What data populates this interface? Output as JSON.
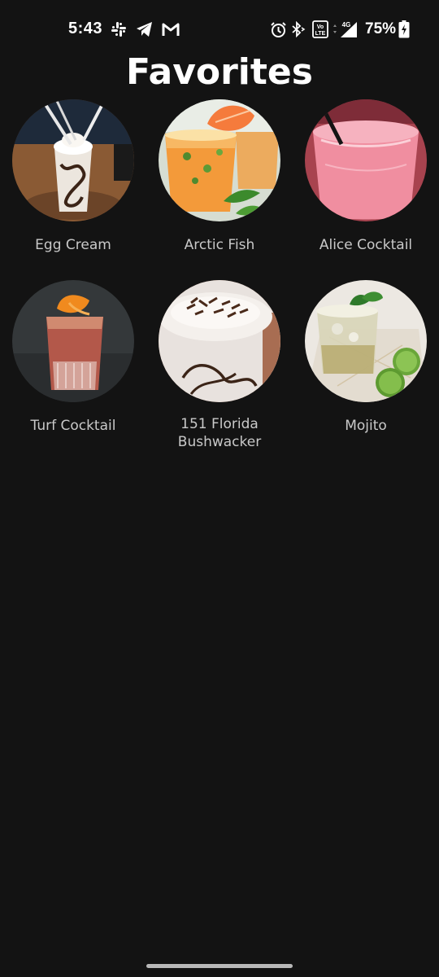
{
  "status_bar": {
    "time": "5:43",
    "battery_percent": "75%",
    "network": "4G",
    "left_icons": [
      "slack-icon",
      "telegram-icon",
      "gmail-icon"
    ],
    "right_icons": [
      "alarm-icon",
      "bluetooth-icon",
      "volte-icon",
      "signal-icon",
      "battery-charging-icon"
    ]
  },
  "title": "Favorites",
  "favorites": [
    {
      "name": "Egg Cream",
      "icon": "egg-cream-photo"
    },
    {
      "name": "Arctic Fish",
      "icon": "arctic-fish-photo"
    },
    {
      "name": "Alice Cocktail",
      "icon": "alice-cocktail-photo"
    },
    {
      "name": "Turf Cocktail",
      "icon": "turf-cocktail-photo"
    },
    {
      "name": "151 Florida Bushwacker",
      "icon": "florida-bushwacker-photo"
    },
    {
      "name": "Mojito",
      "icon": "mojito-photo"
    }
  ],
  "colors": {
    "background": "#131313",
    "title": "#ffffff",
    "label": "#c9c9c9"
  }
}
